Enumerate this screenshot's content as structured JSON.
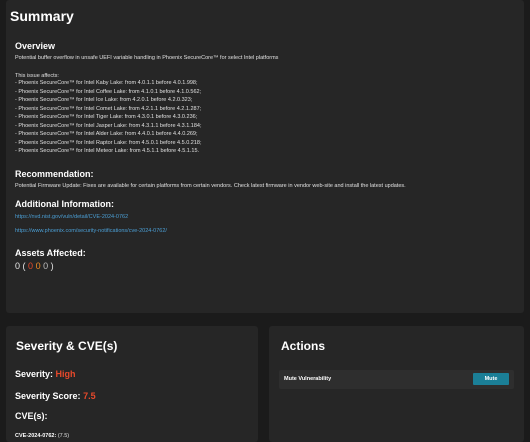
{
  "summary": {
    "title": "Summary",
    "overview_heading": "Overview",
    "overview_text": "Potential buffer overflow in unsafe UEFI variable handling in Phoenix SecureCore™ for select Intel platforms",
    "affects_intro": "This issue affects:",
    "affects": [
      "- Phoenix SecureCore™ for Intel Kaby Lake: from 4.0.1.1 before 4.0.1.998;",
      "- Phoenix SecureCore™ for Intel Coffee Lake: from 4.1.0.1 before 4.1.0.562;",
      "- Phoenix SecureCore™ for Intel Ice Lake: from 4.2.0.1 before 4.2.0.323;",
      "- Phoenix SecureCore™ for Intel Comet Lake: from 4.2.1.1 before 4.2.1.287;",
      "- Phoenix SecureCore™ for Intel Tiger Lake: from 4.3.0.1 before 4.3.0.236;",
      "- Phoenix SecureCore™ for Intel Jasper Lake: from 4.3.1.1 before 4.3.1.184;",
      "- Phoenix SecureCore™ for Intel Alder Lake: from 4.4.0.1 before 4.4.0.269;",
      "- Phoenix SecureCore™ for Intel Raptor Lake: from 4.5.0.1 before 4.5.0.218;",
      "- Phoenix SecureCore™ for Intel Meteor Lake: from 4.5.1.1 before 4.5.1.15."
    ],
    "recommendation_heading": "Recommendation:",
    "recommendation_text": "Potential Firmware Update: Fixes are available for certain platforms from certain vendors. Check latest firmware in vendor web-site and install the latest updates.",
    "additional_heading": "Additional Information:",
    "links": [
      "https://nvd.nist.gov/vuln/detail/CVE-2024-0762",
      "https://www.phoenix.com/security-notifications/cve-2024-0762/"
    ],
    "assets_heading": "Assets Affected:",
    "assets_total": "0",
    "assets_open": "(",
    "assets_critical": "0",
    "assets_high": "0",
    "assets_other": "0",
    "assets_close": ")"
  },
  "severity": {
    "title": "Severity & CVE(s)",
    "severity_label": "Severity:",
    "severity_value": "High",
    "score_label": "Severity Score:",
    "score_value": "7.5",
    "cves_label": "CVE(s):",
    "cve_id": "CVE-2024-0762:",
    "cve_score": "(7.5)"
  },
  "actions": {
    "title": "Actions",
    "rows": [
      {
        "label": "Mute Vulnerability",
        "button": "Mute"
      }
    ]
  },
  "colors": {
    "background": "#1b1b1b",
    "card": "#262626",
    "link": "#4b9fd5",
    "danger": "#e8492b",
    "warning": "#f08a24",
    "button": "#1b7f97"
  }
}
